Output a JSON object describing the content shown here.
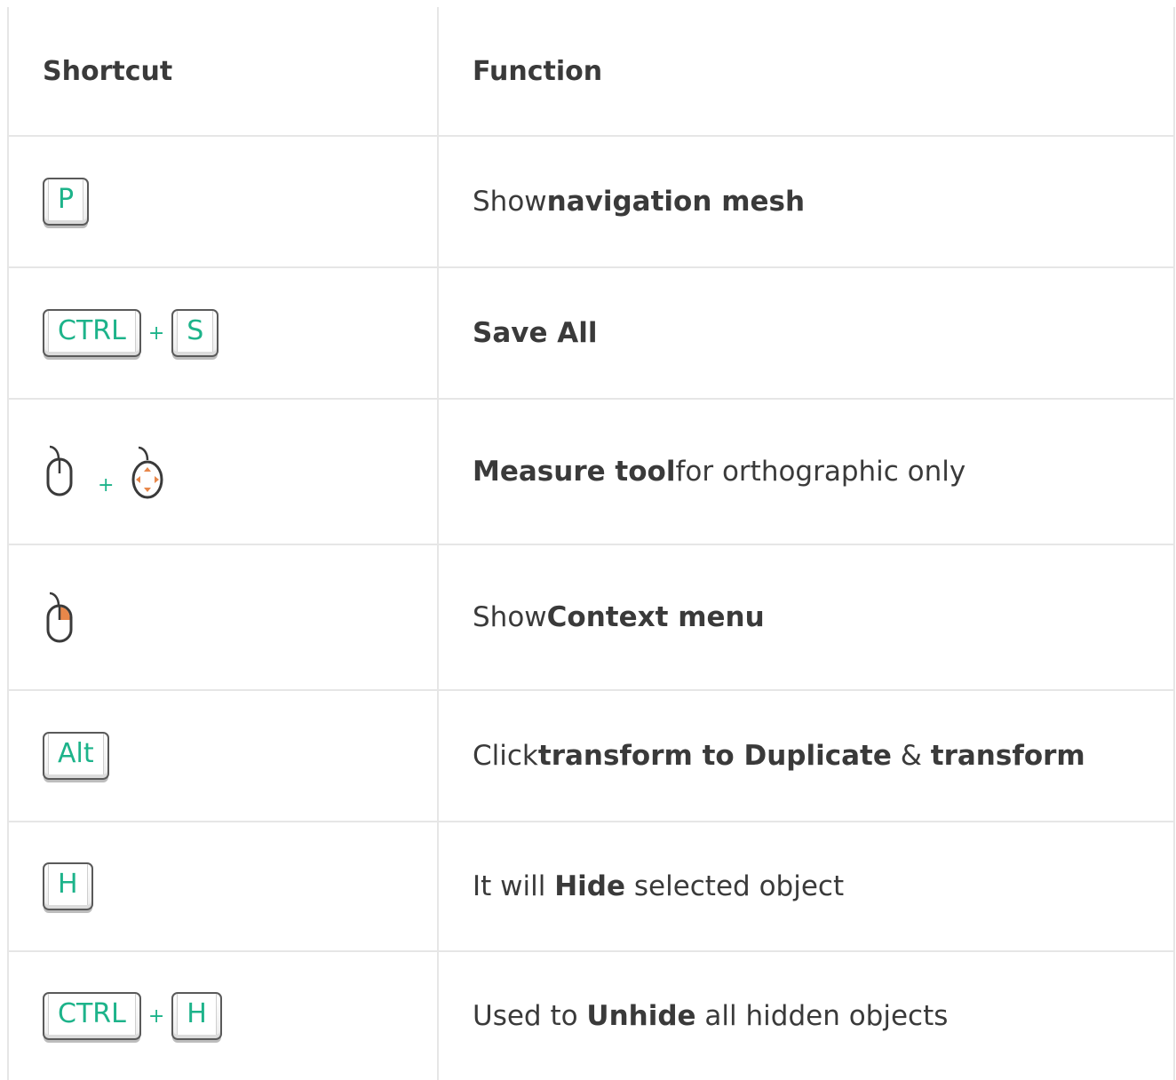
{
  "header": {
    "shortcut": "Shortcut",
    "function": "Function"
  },
  "rows": [
    {
      "keys": [
        "P"
      ],
      "plus": "",
      "desc": [
        {
          "t": "Show ",
          "b": false
        },
        {
          "t": "navigation mesh",
          "b": true
        }
      ]
    },
    {
      "keys": [
        "CTRL",
        "S"
      ],
      "plus": "+",
      "desc": [
        {
          "t": "Save All",
          "b": true
        }
      ]
    },
    {
      "mouse": [
        "left-click-mouse-icon",
        "scroll-mouse-icon"
      ],
      "plus": "+",
      "desc": [
        {
          "t": "Measure tool",
          "b": true
        },
        {
          "t": " for orthographic only",
          "b": false
        }
      ]
    },
    {
      "mouse": [
        "right-click-mouse-icon"
      ],
      "desc": [
        {
          "t": "Show ",
          "b": false
        },
        {
          "t": "Context menu",
          "b": true
        }
      ]
    },
    {
      "keys": [
        "Alt"
      ],
      "desc": [
        {
          "t": "Click ",
          "b": false
        },
        {
          "t": "transform to Duplicate",
          "b": true
        },
        {
          "t": " & ",
          "b": false
        },
        {
          "t": "transform",
          "b": true
        }
      ]
    },
    {
      "keys": [
        "H"
      ],
      "desc": [
        {
          "t": "It will ",
          "b": false
        },
        {
          "t": "Hide",
          "b": true
        },
        {
          "t": " selected object",
          "b": false
        }
      ]
    },
    {
      "keys": [
        "CTRL",
        "H"
      ],
      "plus": "+",
      "desc": [
        {
          "t": "Used to ",
          "b": false
        },
        {
          "t": "Unhide",
          "b": true
        },
        {
          "t": " all hidden objects",
          "b": false
        }
      ]
    }
  ],
  "colors": {
    "key_text": "#1db38a",
    "mouse_accent": "#e8874a",
    "border": "#e6e6e6"
  }
}
